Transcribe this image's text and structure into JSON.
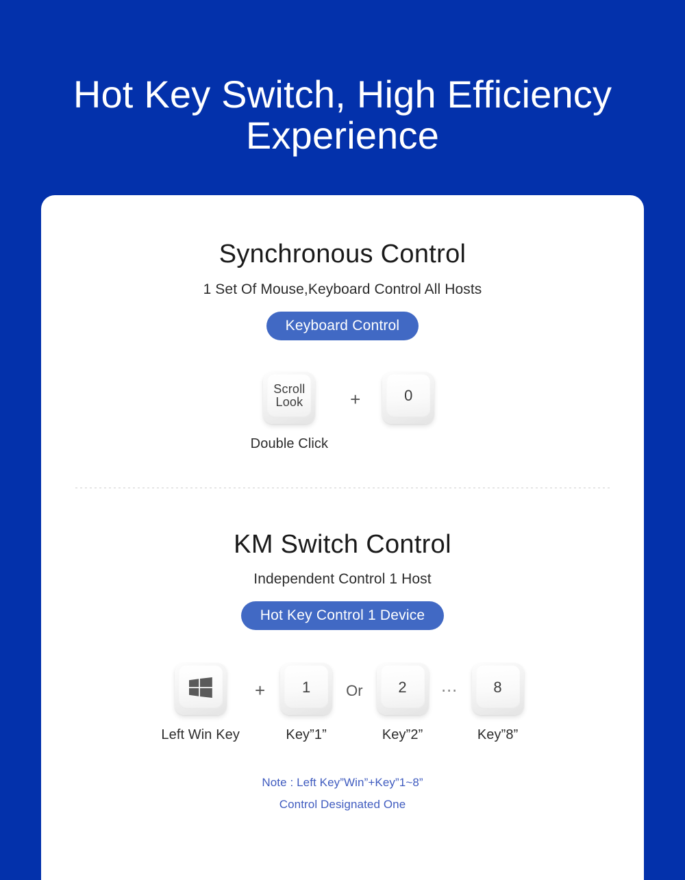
{
  "theme": {
    "background_blue": "#0331ab",
    "badge_blue": "#4169c4",
    "note_blue": "#3f5bbf",
    "card_white": "#ffffff"
  },
  "hero": {
    "title_line_1": "Hot Key Switch, High Efficiency",
    "title_line_2": "Experience"
  },
  "sections": [
    {
      "title": "Synchronous Control",
      "subtitle": "1 Set Of Mouse,Keyboard Control All Hosts",
      "badge": "Keyboard Control",
      "keys": [
        {
          "label_line_1": "Scroll",
          "label_line_2": "Look",
          "caption": "Double Click"
        },
        {
          "label_line_1": "0",
          "label_line_2": "",
          "caption": ""
        }
      ],
      "separators": {
        "plus": "+"
      }
    },
    {
      "title": "KM Switch Control",
      "subtitle": "Independent Control 1 Host",
      "badge": "Hot Key Control 1 Device",
      "keys": [
        {
          "icon": "windows-logo-icon",
          "label": "",
          "caption": "Left Win Key"
        },
        {
          "icon": "",
          "label": "1",
          "caption": "Key”1”"
        },
        {
          "icon": "",
          "label": "2",
          "caption": "Key”2”"
        },
        {
          "icon": "",
          "label": "8",
          "caption": "Key”8”"
        }
      ],
      "separators": {
        "plus": "+",
        "or": "Or",
        "ellipsis": "⋯"
      }
    }
  ],
  "note": {
    "line_1": "Note : Left Key”Win”+Key”1~8”",
    "line_2": "Control Designated One"
  }
}
